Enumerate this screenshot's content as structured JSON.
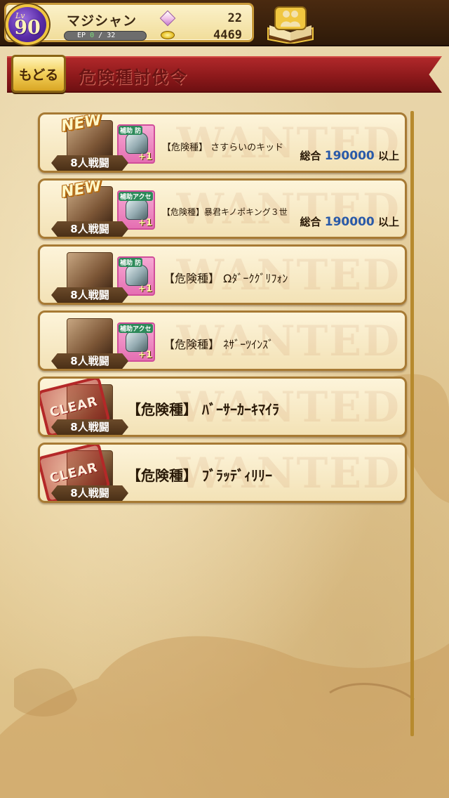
{
  "status": {
    "level_label": "Lv",
    "level": "90",
    "player_name": "マジシャン",
    "ep_label": "EP",
    "ep_current": "0",
    "ep_max": "32",
    "gems": "22",
    "gold": "4469"
  },
  "header": {
    "back_label": "もどる",
    "title": "危険種討伐令"
  },
  "cards": [
    {
      "name": "【危険種】 さすらいのキッド",
      "new": "NEW",
      "party": "8人戦闘",
      "reward_tag": "補助 防",
      "reward_plus": "+1",
      "score_label": "総合",
      "score_value": "190000",
      "score_suffix": "以上"
    },
    {
      "name": "【危険種】暴君キノポキング３世",
      "new": "NEW",
      "party": "8人戦闘",
      "reward_tag": "補助アクセ",
      "reward_plus": "+1",
      "score_label": "総合",
      "score_value": "190000",
      "score_suffix": "以上"
    },
    {
      "name": "【危険種】 Ωﾀﾞｰｸｸﾞﾘﾌｫﾝ",
      "party": "8人戦闘",
      "reward_tag": "補助 防",
      "reward_plus": "+1"
    },
    {
      "name": "【危険種】 ﾈｻﾞｰﾂｲﾝｽﾞ",
      "party": "8人戦闘",
      "reward_tag": "補助アクセ",
      "reward_plus": "+1"
    },
    {
      "name": "【危険種】 ﾊﾞｰｻｰｶｰｷﾏｲﾗ",
      "party": "8人戦闘",
      "stamp": "CLEAR"
    },
    {
      "name": "【危険種】 ﾌﾞﾗｯﾃﾞｨﾘﾘｰ",
      "party": "8人戦闘",
      "stamp": "CLEAR"
    }
  ],
  "watermark": "WANTED"
}
